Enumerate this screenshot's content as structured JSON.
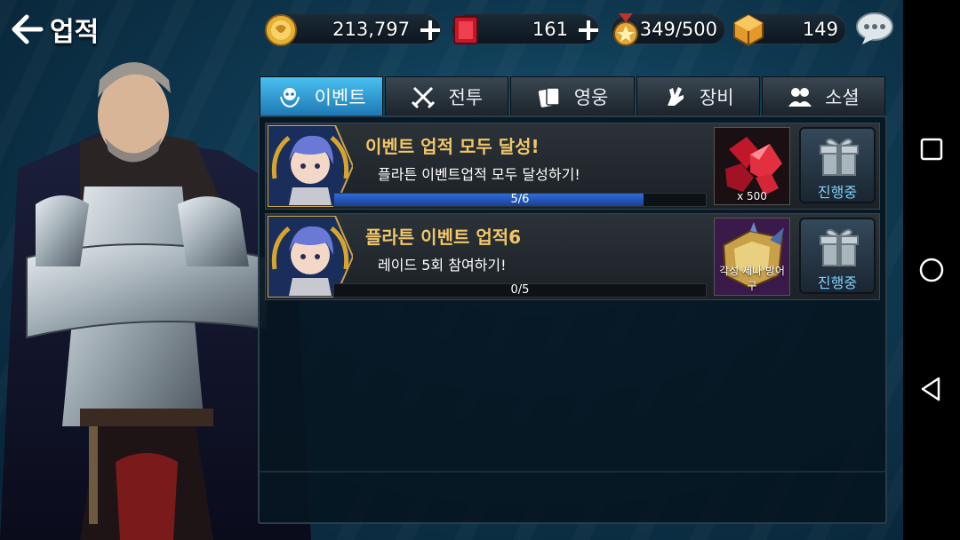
{
  "header": {
    "title": "업적"
  },
  "resources": {
    "gold": "213,797",
    "ruby": "161",
    "medal": "349/500",
    "cube": "149"
  },
  "tabs": [
    {
      "label": "이벤트",
      "icon": "skull-laurel-icon",
      "active": true
    },
    {
      "label": "전투",
      "icon": "crossed-swords-icon",
      "active": false
    },
    {
      "label": "영웅",
      "icon": "cards-icon",
      "active": false
    },
    {
      "label": "장비",
      "icon": "gauntlet-icon",
      "active": false
    },
    {
      "label": "소셜",
      "icon": "people-icon",
      "active": false
    }
  ],
  "achievements": [
    {
      "title": "이벤트 업적 모두 달성!",
      "description": "플라튼 이벤트업적 모두 달성하기!",
      "progress_text": "5/6",
      "progress": 0.8333,
      "reward_label": "x 500",
      "reward_icon": "ruby-pile-icon",
      "status": "진행중"
    },
    {
      "title": "플라튼 이벤트 업적6",
      "description": "레이드 5회 참여하기!",
      "progress_text": "0/5",
      "progress": 0,
      "reward_label": "각성 세나 방어구",
      "reward_icon": "armor-chest-icon",
      "status": "진행중"
    }
  ],
  "colors": {
    "accent_tab": "#2f9ad6",
    "title_gold": "#f1c66a",
    "progress_blue": "#2d6cd8",
    "status_text": "#7fd2ff"
  }
}
